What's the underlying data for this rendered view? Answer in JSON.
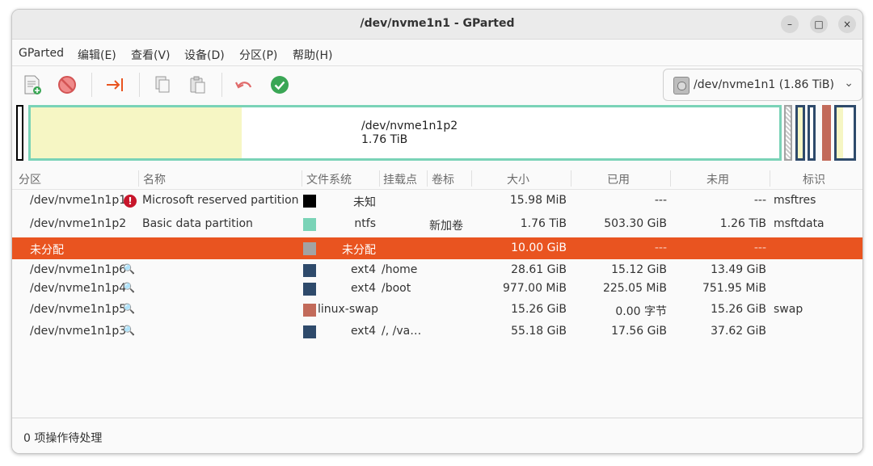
{
  "window": {
    "title": "/dev/nvme1n1 - GParted",
    "controls": {
      "minimize": "–",
      "maximize": "□",
      "close": "×"
    }
  },
  "menubar": {
    "items": [
      "GParted",
      "编辑(E)",
      "查看(V)",
      "设备(D)",
      "分区(P)",
      "帮助(H)"
    ]
  },
  "toolbar": {
    "icons": [
      "new-partition-icon",
      "delete-icon",
      "resize-move-icon",
      "copy-icon",
      "paste-icon",
      "undo-icon",
      "apply-icon"
    ],
    "device_selector": {
      "label": "/dev/nvme1n1 (1.86 TiB)",
      "icon": "disk-icon"
    }
  },
  "diskmap": {
    "main_partition_label": "/dev/nvme1n1p2",
    "main_partition_size": "1.76 TiB",
    "colors": {
      "ntfs": "#7ad3b7",
      "used": "#f6f6c4",
      "ext4": "#2e4a6b",
      "swap": "#c26a5a",
      "msftres": "#000000",
      "unallocated": "#a3a3a3"
    }
  },
  "table": {
    "headers": [
      "分区",
      "名称",
      "文件系统",
      "挂载点",
      "卷标",
      "大小",
      "已用",
      "未用",
      "标识"
    ],
    "rows": [
      {
        "partition": "/dev/nvme1n1p1",
        "status_icon": "warning-icon",
        "name": "Microsoft reserved partition",
        "fs_color": "#000000",
        "fs": "未知",
        "mount": "",
        "label": "",
        "size": "15.98 MiB",
        "used": "---",
        "unused": "---",
        "flags": "msftres",
        "selected": false
      },
      {
        "partition": "/dev/nvme1n1p2",
        "status_icon": "",
        "name": "Basic data partition",
        "fs_color": "#7ad3b7",
        "fs": "ntfs",
        "mount": "",
        "label": "新加卷",
        "size": "1.76 TiB",
        "used": "503.30 GiB",
        "unused": "1.26 TiB",
        "flags": "msftdata",
        "selected": false
      },
      {
        "partition": "未分配",
        "status_icon": "",
        "name": "",
        "fs_color": "#a3a3a3",
        "fs": "未分配",
        "mount": "",
        "label": "",
        "size": "10.00 GiB",
        "used": "---",
        "unused": "---",
        "flags": "",
        "selected": true
      },
      {
        "partition": "/dev/nvme1n1p6",
        "status_icon": "key-icon",
        "name": "",
        "fs_color": "#2e4a6b",
        "fs": "ext4",
        "mount": "/home",
        "label": "",
        "size": "28.61 GiB",
        "used": "15.12 GiB",
        "unused": "13.49 GiB",
        "flags": "",
        "selected": false
      },
      {
        "partition": "/dev/nvme1n1p4",
        "status_icon": "key-icon",
        "name": "",
        "fs_color": "#2e4a6b",
        "fs": "ext4",
        "mount": "/boot",
        "label": "",
        "size": "977.00 MiB",
        "used": "225.05 MiB",
        "unused": "751.95 MiB",
        "flags": "",
        "selected": false
      },
      {
        "partition": "/dev/nvme1n1p5",
        "status_icon": "key-icon",
        "name": "",
        "fs_color": "#c26a5a",
        "fs": "linux-swap",
        "mount": "",
        "label": "",
        "size": "15.26 GiB",
        "used": "0.00 字节",
        "unused": "15.26 GiB",
        "flags": "swap",
        "selected": false
      },
      {
        "partition": "/dev/nvme1n1p3",
        "status_icon": "key-icon",
        "name": "",
        "fs_color": "#2e4a6b",
        "fs": "ext4",
        "mount": "/, /va…",
        "label": "",
        "size": "55.18 GiB",
        "used": "17.56 GiB",
        "unused": "37.62 GiB",
        "flags": "",
        "selected": false
      }
    ]
  },
  "statusbar": {
    "text": "0 项操作待处理"
  }
}
